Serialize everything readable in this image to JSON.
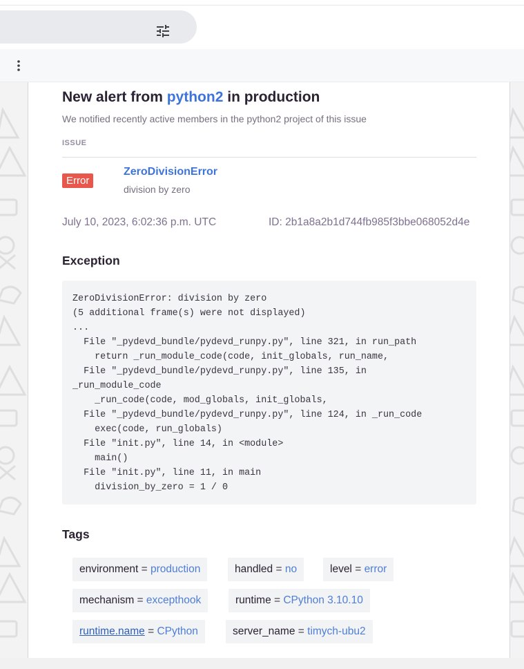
{
  "toolbar": {
    "filter_icon": "tune-icon",
    "more_icon": "more-vertical-icon"
  },
  "alert": {
    "title_prefix": "New alert from",
    "project": "python2",
    "title_suffix": "in production",
    "subtitle": "We notified recently active members in the python2 project of this issue",
    "section_label": "ISSUE"
  },
  "issue": {
    "level_badge": "Error",
    "title": "ZeroDivisionError",
    "message": "division by zero",
    "date": "July 10, 2023, 6:02:36 p.m. UTC",
    "id": "ID: 2b1a8a2b1d744fb985f3bbe068052d4e"
  },
  "exception": {
    "heading": "Exception",
    "lines": [
      "ZeroDivisionError: division by zero",
      "(5 additional frame(s) were not displayed)",
      "...",
      "  File \"_pydevd_bundle/pydevd_runpy.py\", line 321, in run_path",
      "    return _run_module_code(code, init_globals, run_name,",
      "  File \"_pydevd_bundle/pydevd_runpy.py\", line 135, in",
      "_run_module_code",
      "    _run_code(code, mod_globals, init_globals,",
      "  File \"_pydevd_bundle/pydevd_runpy.py\", line 124, in _run_code",
      "    exec(code, run_globals)",
      "  File \"init.py\", line 14, in <module>",
      "    main()",
      "  File \"init.py\", line 11, in main",
      "    division_by_zero = 1 / 0"
    ]
  },
  "tags": {
    "heading": "Tags",
    "items": [
      {
        "key": "environment",
        "eq": " = ",
        "value": "production"
      },
      {
        "key": "handled",
        "eq": " = ",
        "value": "no"
      },
      {
        "key": "level",
        "eq": " = ",
        "value": "error"
      },
      {
        "key": "mechanism",
        "eq": " = ",
        "value": "excepthook"
      },
      {
        "key": "runtime",
        "eq": " = ",
        "value": "CPython 3.10.10"
      },
      {
        "key": "runtime.name",
        "eq": " = ",
        "value": "CPython"
      },
      {
        "key": "server_name",
        "eq": " = ",
        "value": "timych-ubu2"
      }
    ]
  },
  "colors": {
    "accent": "#3d74db",
    "badge_error": "#e8574b",
    "tag_value": "#4f7ed4"
  }
}
